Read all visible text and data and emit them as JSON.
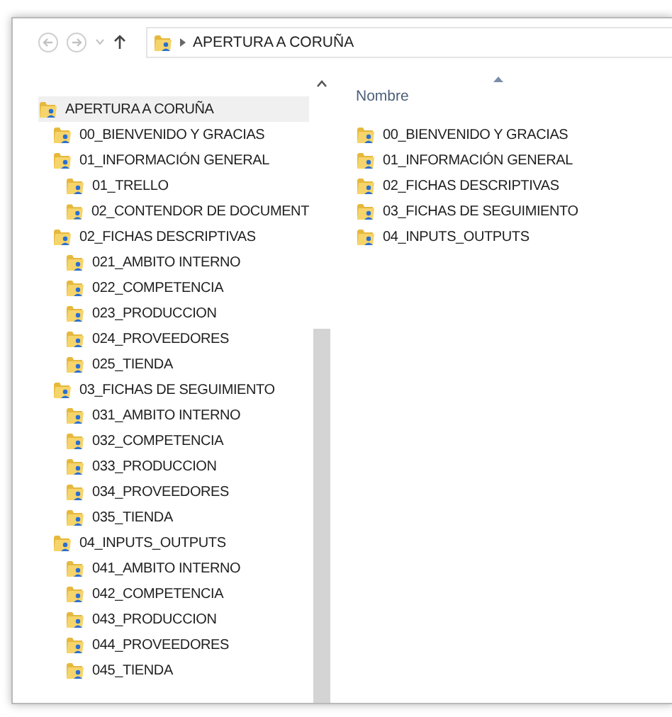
{
  "address_bar": {
    "path": "APERTURA A CORUÑA"
  },
  "navigation_tree": [
    {
      "label": "APERTURA A CORUÑA",
      "selected": true,
      "children": [
        {
          "label": "00_BIENVENIDO Y GRACIAS",
          "selected": false
        },
        {
          "label": "01_INFORMACIÓN GENERAL",
          "selected": false,
          "children": [
            {
              "label": "01_TRELLO",
              "selected": false
            },
            {
              "label": "02_CONTENDOR DE DOCUMENT",
              "selected": false
            }
          ]
        },
        {
          "label": "02_FICHAS DESCRIPTIVAS",
          "selected": false,
          "children": [
            {
              "label": "021_AMBITO INTERNO",
              "selected": false
            },
            {
              "label": "022_COMPETENCIA",
              "selected": false
            },
            {
              "label": "023_PRODUCCION",
              "selected": false
            },
            {
              "label": "024_PROVEEDORES",
              "selected": false
            },
            {
              "label": "025_TIENDA",
              "selected": false
            }
          ]
        },
        {
          "label": "03_FICHAS DE SEGUIMIENTO",
          "selected": false,
          "children": [
            {
              "label": "031_AMBITO INTERNO",
              "selected": false
            },
            {
              "label": "032_COMPETENCIA",
              "selected": false
            },
            {
              "label": "033_PRODUCCION",
              "selected": false
            },
            {
              "label": "034_PROVEEDORES",
              "selected": false
            },
            {
              "label": "035_TIENDA",
              "selected": false
            }
          ]
        },
        {
          "label": "04_INPUTS_OUTPUTS",
          "selected": false,
          "children": [
            {
              "label": "041_AMBITO INTERNO",
              "selected": false
            },
            {
              "label": "042_COMPETENCIA",
              "selected": false
            },
            {
              "label": "043_PRODUCCION",
              "selected": false
            },
            {
              "label": "044_PROVEEDORES",
              "selected": false
            },
            {
              "label": "045_TIENDA",
              "selected": false
            }
          ]
        }
      ]
    }
  ],
  "file_list": {
    "columns": [
      "Nombre"
    ],
    "items": [
      "00_BIENVENIDO Y GRACIAS",
      "01_INFORMACIÓN GENERAL",
      "02_FICHAS DESCRIPTIVAS",
      "03_FICHAS DE SEGUIMIENTO",
      "04_INPUTS_OUTPUTS"
    ]
  }
}
